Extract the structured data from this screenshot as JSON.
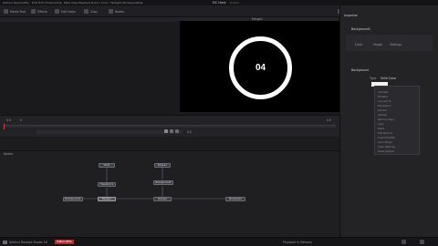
{
  "app": {
    "name": "DaVinci Resolve Studio 18",
    "badge": "PUBLIC BETA",
    "project_title": "DC time",
    "edited_label": "Edited"
  },
  "menubar": [
    "DaVinci Resolve",
    "File",
    "Edit",
    "Trim",
    "Timeline",
    "Clip",
    "Mark",
    "View",
    "Playback",
    "Fusion",
    "Color",
    "Fairlight",
    "Workspace",
    "Help"
  ],
  "toolbar": {
    "left": [
      "Media Pool",
      "Effects",
      "Edit Index",
      "Clips",
      "Nodes"
    ],
    "right": [
      "Spline",
      "Keyframes",
      "Metadata",
      "Inspector"
    ]
  },
  "viewer": {
    "title": "Merge1",
    "countdown_number": "04",
    "left_timecode": "0.0",
    "right_timecode": "0.0"
  },
  "inspector": {
    "title": "Inspector",
    "node_name": "Background1",
    "tabs": [
      "Color",
      "Image",
      "Settings"
    ],
    "section": "Background",
    "type_label": "Type",
    "type_value": "Solid Color"
  },
  "context_menu": {
    "items": [
      "Animate",
      "Modifier",
      "Connect To",
      "Expression",
      "Publish",
      "Set Key",
      "Remove Keys",
      "Copy",
      "Paste",
      "Edit Params",
      "Insert Modifier",
      "Color Picker",
      "Clear Settings",
      "Reset Default"
    ]
  },
  "nodes": {
    "panel_title": "Nodes",
    "items": [
      "Text1",
      "Ellipse1",
      "Transform1",
      "Background2",
      "Background1",
      "Merge1",
      "Merge2",
      "MediaOut1"
    ]
  },
  "timeline": {
    "range_start": "0",
    "range_end": "100",
    "current": "0.0"
  },
  "status": {
    "left": "DaVinci Resolve Studio 18",
    "right": "Playback in Memory",
    "info": "12.5% - 2.4GB/s"
  }
}
